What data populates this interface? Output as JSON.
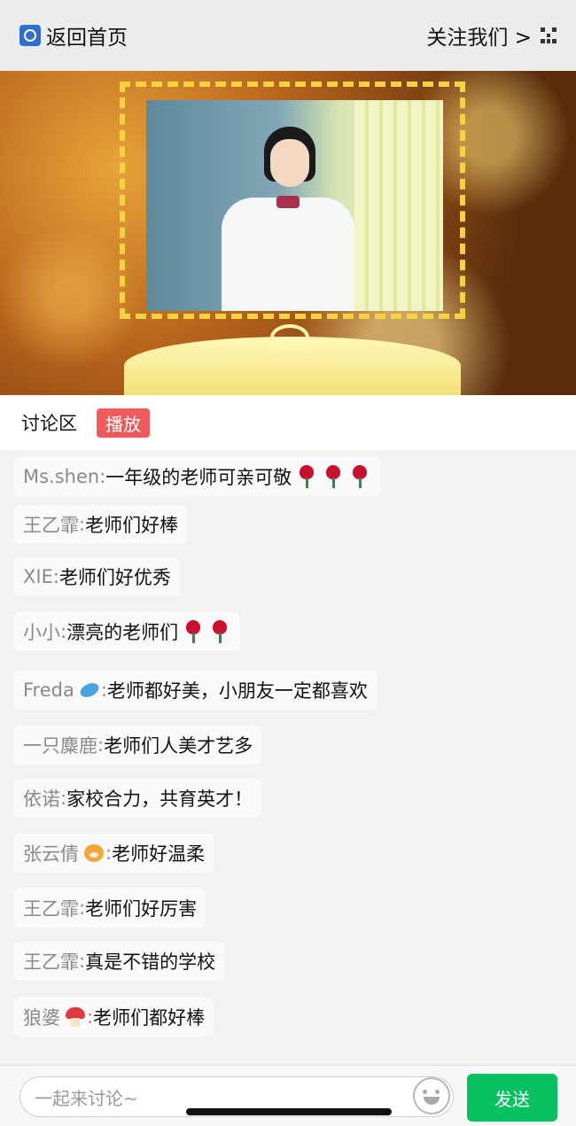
{
  "header": {
    "back_label": "返回首页",
    "follow_label": "关注我们 >"
  },
  "tabs": {
    "discuss": "讨论区",
    "play": "播放"
  },
  "messages": [
    {
      "name": "Ms.shen",
      "sep": ": ",
      "text": "一年级的老师可亲可敬",
      "emojis": [
        "rose",
        "rose",
        "rose"
      ]
    },
    {
      "name": "王乙霏",
      "sep": ": ",
      "text": "老师们好棒",
      "emojis": []
    },
    {
      "name": "XIE",
      "sep": ": ",
      "text": "老师们好优秀",
      "emojis": []
    },
    {
      "name": "小小",
      "sep": ": ",
      "text": "漂亮的老师们",
      "emojis": [
        "rose",
        "rose"
      ]
    },
    {
      "name": "Freda",
      "name_emoji": "dolphin",
      "sep": ": ",
      "text": "老师都好美，小朋友一定都喜欢",
      "emojis": []
    },
    {
      "name": "一只麋鹿",
      "sep": ": ",
      "text": "老师们人美才艺多",
      "emojis": []
    },
    {
      "name": "依诺",
      "sep": ": ",
      "text": "家校合力，共育英才！",
      "emojis": []
    },
    {
      "name": "张云倩",
      "name_emoji": "tiger",
      "sep": ": ",
      "text": "老师好温柔",
      "emojis": []
    },
    {
      "name": "王乙霏",
      "sep": ": ",
      "text": "老师们好厉害",
      "emojis": []
    },
    {
      "name": "王乙霏",
      "sep": ": ",
      "text": "真是不错的学校",
      "emojis": []
    },
    {
      "name": "狼婆",
      "name_emoji": "mushroom",
      "sep": ": ",
      "text": "老师们都好棒",
      "emojis": []
    }
  ],
  "composer": {
    "placeholder": "一起来讨论~",
    "send_label": "发送"
  },
  "colors": {
    "send": "#07c160",
    "play_badge": "#f05a5a",
    "frame": "#f7d341"
  }
}
